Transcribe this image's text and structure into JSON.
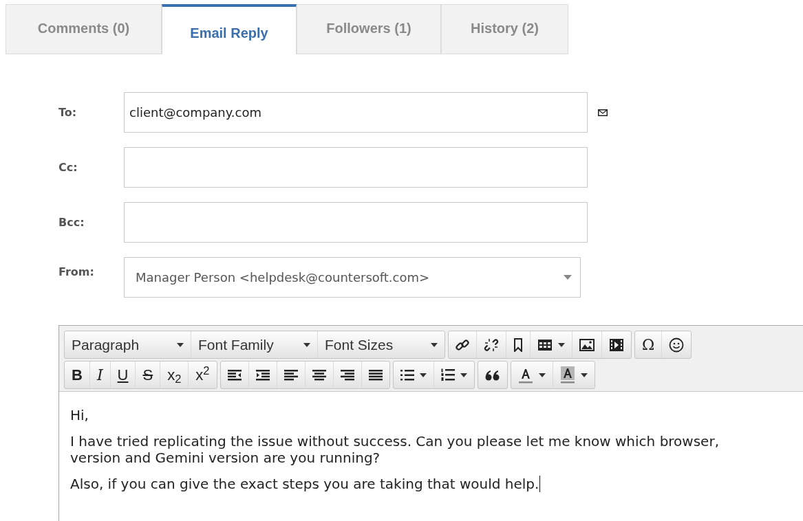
{
  "tabs": [
    {
      "label": "Comments (0)",
      "selected": false
    },
    {
      "label": "Email Reply",
      "selected": true
    },
    {
      "label": "Followers (1)",
      "selected": false
    },
    {
      "label": "History (2)",
      "selected": false
    }
  ],
  "fields": [
    {
      "label": "To:",
      "kind": "text",
      "value": "client@company.com",
      "address_book": true
    },
    {
      "label": "Cc:",
      "kind": "text",
      "address_book": false
    },
    {
      "label": "Bcc:",
      "kind": "text",
      "address_book": false
    },
    {
      "label": "From:",
      "kind": "select",
      "value": "Manager Person <helpdesk@countersoft.com>",
      "address_book": false
    }
  ],
  "toolbar": [
    [
      [
        {
          "kind": "dropdown",
          "label": "Paragraph"
        },
        {
          "kind": "dropdown",
          "label": "Font Family"
        },
        {
          "kind": "dropdown",
          "label": "Font Sizes"
        }
      ],
      [
        {
          "kind": "link",
          "caret": false
        },
        {
          "kind": "unlink",
          "caret": false
        },
        {
          "kind": "bookmark",
          "caret": false
        },
        {
          "kind": "table",
          "caret": true
        },
        {
          "kind": "image",
          "caret": false
        },
        {
          "kind": "media",
          "caret": false
        }
      ],
      [
        {
          "kind": "glyph",
          "label": "Ω",
          "caret": false
        },
        {
          "kind": "emoticon",
          "caret": false
        }
      ]
    ],
    [
      [
        {
          "kind": "bold",
          "label": "B"
        },
        {
          "kind": "italic",
          "label": "I"
        },
        {
          "kind": "underline",
          "label": "U"
        },
        {
          "kind": "strike",
          "label": "S"
        },
        {
          "kind": "plain",
          "label": "x$_{2}$"
        },
        {
          "kind": "plain",
          "label": "x$^{2}$"
        }
      ],
      [
        {
          "kind": "outdent",
          "caret": false
        },
        {
          "kind": "indent",
          "caret": false
        },
        {
          "kind": "align-left",
          "caret": false
        },
        {
          "kind": "align-center",
          "caret": false
        },
        {
          "kind": "align-right",
          "caret": false
        },
        {
          "kind": "justify",
          "caret": false
        }
      ],
      [
        {
          "kind": "bullets",
          "caret": true
        },
        {
          "kind": "numbers",
          "caret": true
        }
      ],
      [
        {
          "kind": "quote",
          "caret": false
        }
      ],
      [
        {
          "kind": "text-color",
          "caret": true
        },
        {
          "kind": "highlight",
          "caret": true
        }
      ]
    ]
  ],
  "body": [
    "Hi,",
    "I have tried replicating the issue without success. Can you please let me know which browser, version and Gemini version are you running?",
    "Also, if you can give the exact steps you are taking that would help."
  ]
}
